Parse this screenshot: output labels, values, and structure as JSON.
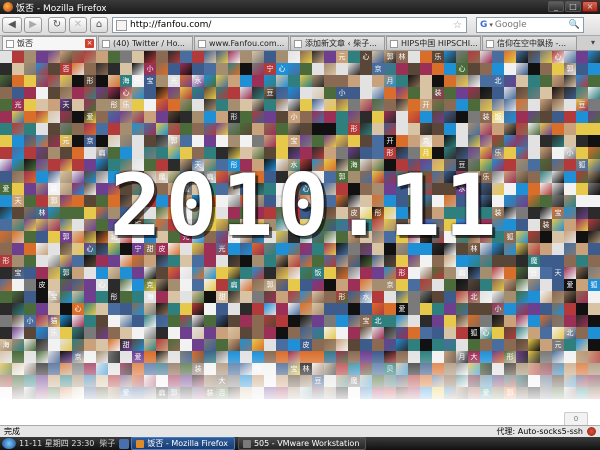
{
  "window": {
    "title": "饭否 - Mozilla Firefox",
    "controls": [
      "_",
      "□",
      "×"
    ]
  },
  "toolbar": {
    "back_glyph": "◀",
    "forward_glyph": "▶",
    "refresh_glyph": "↻",
    "stop_glyph": "✕",
    "home_glyph": "⌂",
    "url": "http://fanfou.com/",
    "search_engine": "G",
    "search_placeholder": "Google",
    "search_glyph": "🔍"
  },
  "tabs": [
    {
      "label": "饭否",
      "active": true
    },
    {
      "label": "(40) Twitter / Ho..."
    },
    {
      "label": "www.Fanfou.com..."
    },
    {
      "label": "添加新文章 ‹ 柴子..."
    },
    {
      "label": "HIPS中国 HIPSCHI..."
    },
    {
      "label": "信仰在空中飘扬 -..."
    }
  ],
  "content": {
    "headline": "2010.11",
    "page_widget": "0",
    "tile_chars": [
      "饭",
      "否",
      "皮",
      "扁",
      "水",
      "乐",
      "小",
      "宝",
      "贝",
      "猫",
      "开",
      "心",
      "郭",
      "装",
      "克",
      "豆",
      "大",
      "元",
      "光",
      "月",
      "爱",
      "天",
      "狐",
      "海",
      "林",
      "北",
      "京",
      "甜",
      "宁",
      "彤",
      "魔",
      "形"
    ]
  },
  "colors": {
    "palette": [
      "#2b2b2b",
      "#5a4636",
      "#8a6a52",
      "#c9a27c",
      "#d8c3a5",
      "#3d5c8c",
      "#1f8fd6",
      "#7a7a7a",
      "#b33a3a",
      "#e2e2e2",
      "#4b6b3a",
      "#a58d6f",
      "#111111",
      "#6d3f8e",
      "#d96d2a",
      "#e6c94a",
      "#2f7f7f",
      "#f2f2f2",
      "#9c2f55",
      "#486d9e"
    ]
  },
  "status": {
    "text": "完成",
    "proxy": "代理: Auto-socks5-ssh"
  },
  "taskbar": {
    "clock": "11-11 星期四 23:30",
    "quick_launch": "柴子",
    "tasks": [
      {
        "label": "饭否 - Mozilla Firefox",
        "active": true
      },
      {
        "label": "505 - VMware Workstation"
      }
    ]
  }
}
